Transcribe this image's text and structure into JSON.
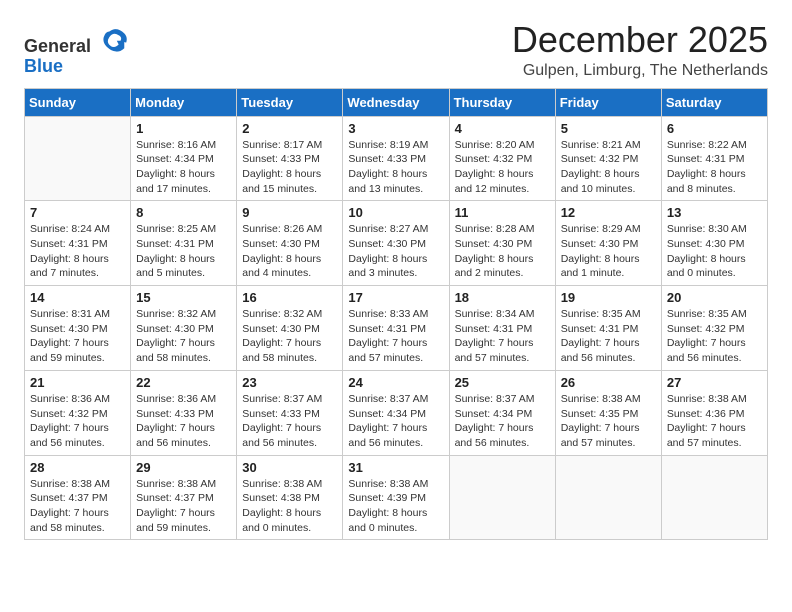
{
  "logo": {
    "general": "General",
    "blue": "Blue"
  },
  "title": {
    "month": "December 2025",
    "location": "Gulpen, Limburg, The Netherlands"
  },
  "header": {
    "days": [
      "Sunday",
      "Monday",
      "Tuesday",
      "Wednesday",
      "Thursday",
      "Friday",
      "Saturday"
    ]
  },
  "weeks": [
    [
      {
        "day": "",
        "info": ""
      },
      {
        "day": "1",
        "info": "Sunrise: 8:16 AM\nSunset: 4:34 PM\nDaylight: 8 hours\nand 17 minutes."
      },
      {
        "day": "2",
        "info": "Sunrise: 8:17 AM\nSunset: 4:33 PM\nDaylight: 8 hours\nand 15 minutes."
      },
      {
        "day": "3",
        "info": "Sunrise: 8:19 AM\nSunset: 4:33 PM\nDaylight: 8 hours\nand 13 minutes."
      },
      {
        "day": "4",
        "info": "Sunrise: 8:20 AM\nSunset: 4:32 PM\nDaylight: 8 hours\nand 12 minutes."
      },
      {
        "day": "5",
        "info": "Sunrise: 8:21 AM\nSunset: 4:32 PM\nDaylight: 8 hours\nand 10 minutes."
      },
      {
        "day": "6",
        "info": "Sunrise: 8:22 AM\nSunset: 4:31 PM\nDaylight: 8 hours\nand 8 minutes."
      }
    ],
    [
      {
        "day": "7",
        "info": "Sunrise: 8:24 AM\nSunset: 4:31 PM\nDaylight: 8 hours\nand 7 minutes."
      },
      {
        "day": "8",
        "info": "Sunrise: 8:25 AM\nSunset: 4:31 PM\nDaylight: 8 hours\nand 5 minutes."
      },
      {
        "day": "9",
        "info": "Sunrise: 8:26 AM\nSunset: 4:30 PM\nDaylight: 8 hours\nand 4 minutes."
      },
      {
        "day": "10",
        "info": "Sunrise: 8:27 AM\nSunset: 4:30 PM\nDaylight: 8 hours\nand 3 minutes."
      },
      {
        "day": "11",
        "info": "Sunrise: 8:28 AM\nSunset: 4:30 PM\nDaylight: 8 hours\nand 2 minutes."
      },
      {
        "day": "12",
        "info": "Sunrise: 8:29 AM\nSunset: 4:30 PM\nDaylight: 8 hours\nand 1 minute."
      },
      {
        "day": "13",
        "info": "Sunrise: 8:30 AM\nSunset: 4:30 PM\nDaylight: 8 hours\nand 0 minutes."
      }
    ],
    [
      {
        "day": "14",
        "info": "Sunrise: 8:31 AM\nSunset: 4:30 PM\nDaylight: 7 hours\nand 59 minutes."
      },
      {
        "day": "15",
        "info": "Sunrise: 8:32 AM\nSunset: 4:30 PM\nDaylight: 7 hours\nand 58 minutes."
      },
      {
        "day": "16",
        "info": "Sunrise: 8:32 AM\nSunset: 4:30 PM\nDaylight: 7 hours\nand 58 minutes."
      },
      {
        "day": "17",
        "info": "Sunrise: 8:33 AM\nSunset: 4:31 PM\nDaylight: 7 hours\nand 57 minutes."
      },
      {
        "day": "18",
        "info": "Sunrise: 8:34 AM\nSunset: 4:31 PM\nDaylight: 7 hours\nand 57 minutes."
      },
      {
        "day": "19",
        "info": "Sunrise: 8:35 AM\nSunset: 4:31 PM\nDaylight: 7 hours\nand 56 minutes."
      },
      {
        "day": "20",
        "info": "Sunrise: 8:35 AM\nSunset: 4:32 PM\nDaylight: 7 hours\nand 56 minutes."
      }
    ],
    [
      {
        "day": "21",
        "info": "Sunrise: 8:36 AM\nSunset: 4:32 PM\nDaylight: 7 hours\nand 56 minutes."
      },
      {
        "day": "22",
        "info": "Sunrise: 8:36 AM\nSunset: 4:33 PM\nDaylight: 7 hours\nand 56 minutes."
      },
      {
        "day": "23",
        "info": "Sunrise: 8:37 AM\nSunset: 4:33 PM\nDaylight: 7 hours\nand 56 minutes."
      },
      {
        "day": "24",
        "info": "Sunrise: 8:37 AM\nSunset: 4:34 PM\nDaylight: 7 hours\nand 56 minutes."
      },
      {
        "day": "25",
        "info": "Sunrise: 8:37 AM\nSunset: 4:34 PM\nDaylight: 7 hours\nand 56 minutes."
      },
      {
        "day": "26",
        "info": "Sunrise: 8:38 AM\nSunset: 4:35 PM\nDaylight: 7 hours\nand 57 minutes."
      },
      {
        "day": "27",
        "info": "Sunrise: 8:38 AM\nSunset: 4:36 PM\nDaylight: 7 hours\nand 57 minutes."
      }
    ],
    [
      {
        "day": "28",
        "info": "Sunrise: 8:38 AM\nSunset: 4:37 PM\nDaylight: 7 hours\nand 58 minutes."
      },
      {
        "day": "29",
        "info": "Sunrise: 8:38 AM\nSunset: 4:37 PM\nDaylight: 7 hours\nand 59 minutes."
      },
      {
        "day": "30",
        "info": "Sunrise: 8:38 AM\nSunset: 4:38 PM\nDaylight: 8 hours\nand 0 minutes."
      },
      {
        "day": "31",
        "info": "Sunrise: 8:38 AM\nSunset: 4:39 PM\nDaylight: 8 hours\nand 0 minutes."
      },
      {
        "day": "",
        "info": ""
      },
      {
        "day": "",
        "info": ""
      },
      {
        "day": "",
        "info": ""
      }
    ]
  ]
}
